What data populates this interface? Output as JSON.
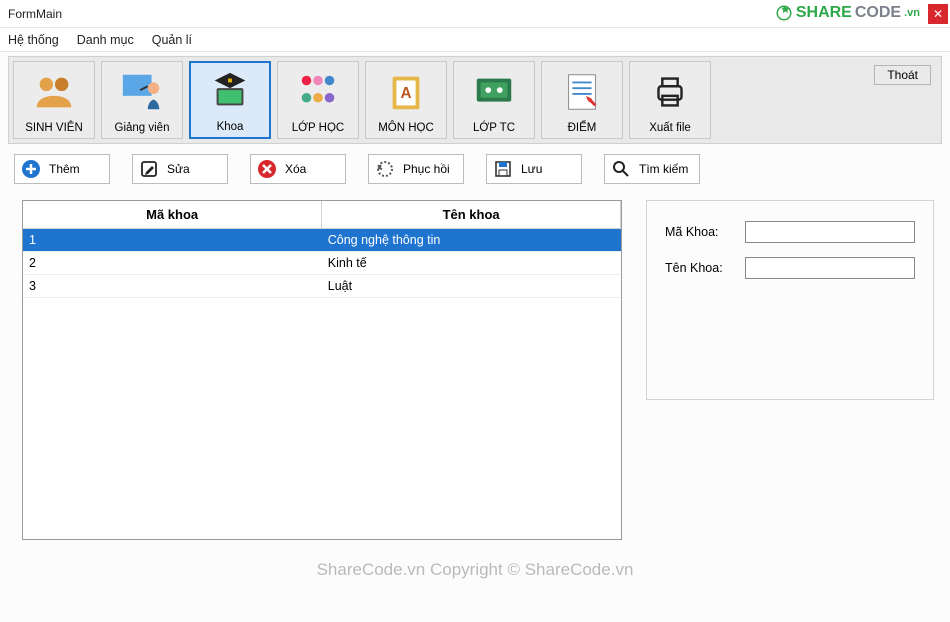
{
  "window": {
    "title": "FormMain"
  },
  "menu": {
    "items": [
      "Hệ thống",
      "Danh mục",
      "Quản lí"
    ]
  },
  "ribbon": {
    "items": [
      {
        "label": "SINH VIÊN",
        "icon": "students",
        "selected": false
      },
      {
        "label": "Giảng viên",
        "icon": "teacher",
        "selected": false
      },
      {
        "label": "Khoa",
        "icon": "graduation",
        "selected": true
      },
      {
        "label": "LỚP HỌC",
        "icon": "class",
        "selected": false
      },
      {
        "label": "MÔN HỌC",
        "icon": "book",
        "selected": false
      },
      {
        "label": "LỚP TC",
        "icon": "board",
        "selected": false
      },
      {
        "label": "ĐIỂM",
        "icon": "scoresheet",
        "selected": false
      },
      {
        "label": "Xuất file",
        "icon": "printer",
        "selected": false
      }
    ],
    "exit_label": "Thoát"
  },
  "actions": [
    {
      "label": "Thêm",
      "icon": "plus",
      "color": "#1f74d0"
    },
    {
      "label": "Sửa",
      "icon": "edit",
      "color": "#222"
    },
    {
      "label": "Xóa",
      "icon": "remove",
      "color": "#d9272e"
    },
    {
      "label": "Phục hồi",
      "icon": "restore",
      "color": "#555"
    },
    {
      "label": "Lưu",
      "icon": "save",
      "color": "#1f74d0"
    },
    {
      "label": "Tìm kiếm",
      "icon": "search",
      "color": "#222"
    }
  ],
  "grid": {
    "columns": [
      "Mã khoa",
      "Tên khoa"
    ],
    "rows": [
      {
        "ma": "1",
        "ten": "Công nghệ thông tin",
        "selected": true
      },
      {
        "ma": "2",
        "ten": "Kinh tế",
        "selected": false
      },
      {
        "ma": "3",
        "ten": "Luật",
        "selected": false
      }
    ]
  },
  "form": {
    "fields": [
      {
        "label": "Mã Khoa:",
        "value": ""
      },
      {
        "label": "Tên Khoa:",
        "value": ""
      }
    ]
  },
  "watermark": {
    "brand_share": "SHARE",
    "brand_code": "CODE",
    "brand_vn": ".vn",
    "bottom": "ShareCode.vn    Copyright © ShareCode.vn"
  }
}
